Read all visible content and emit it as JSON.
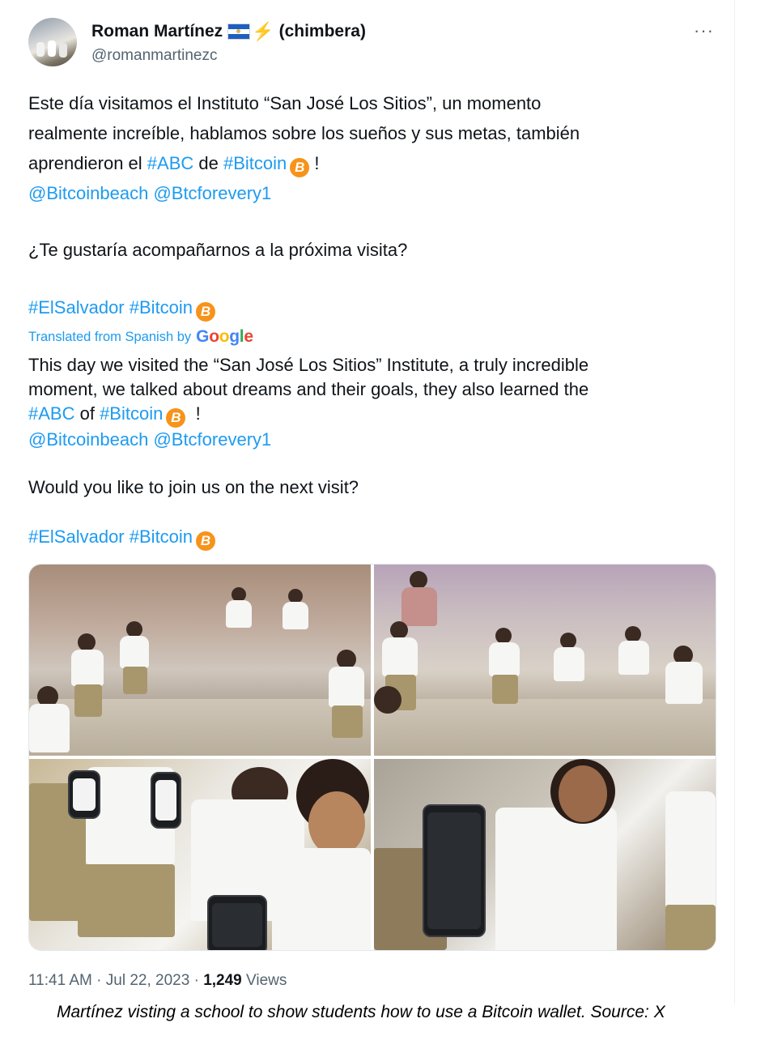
{
  "author": {
    "name": "Roman Martínez",
    "nickname": "(chimbera)",
    "handle": "@romanmartinezc",
    "flag_icon": "el-salvador-flag-icon",
    "badge_icon": "lightning-bolt-icon"
  },
  "tweet": {
    "line1": "Este día visitamos el Instituto “San José Los Sitios”, un momento",
    "line2": "realmente increíble, hablamos sobre los sueños y sus metas, también",
    "line3_prefix": "aprendieron el ",
    "tag_abc": "#ABC",
    "de": " de ",
    "tag_bitcoin": "#Bitcoin",
    "exclaim": " !",
    "mention1": "@Bitcoinbeach",
    "mention2": "@Btcforevery1",
    "question": "¿Te gustaría acompañarnos a la próxima visita?",
    "tag_elsalvador": "#ElSalvador"
  },
  "translation": {
    "label": "Translated from Spanish by",
    "google": [
      "G",
      "o",
      "o",
      "g",
      "l",
      "e"
    ],
    "line1": "This day we visited the “San José Los Sitios” Institute, a truly incredible",
    "line2": "moment, we talked about dreams and their goals, they also learned the",
    "of": " of ",
    "question": "Would you like to join us on the next visit?"
  },
  "btc_symbol": "B",
  "more_menu": "···",
  "photos": [
    {
      "alt": ""
    },
    {
      "alt": ""
    },
    {
      "alt": ""
    },
    {
      "alt": ""
    }
  ],
  "meta": {
    "time": "11:41 AM",
    "sep": " · ",
    "date": "Jul 22, 2023",
    "views_count": "1,249",
    "views_label": " Views"
  },
  "caption": "Martínez visting a school to show students how to use a Bitcoin wallet. Source: X",
  "colors": {
    "link": "#1d9bf0",
    "bitcoin": "#f7931a",
    "muted": "#536471"
  }
}
